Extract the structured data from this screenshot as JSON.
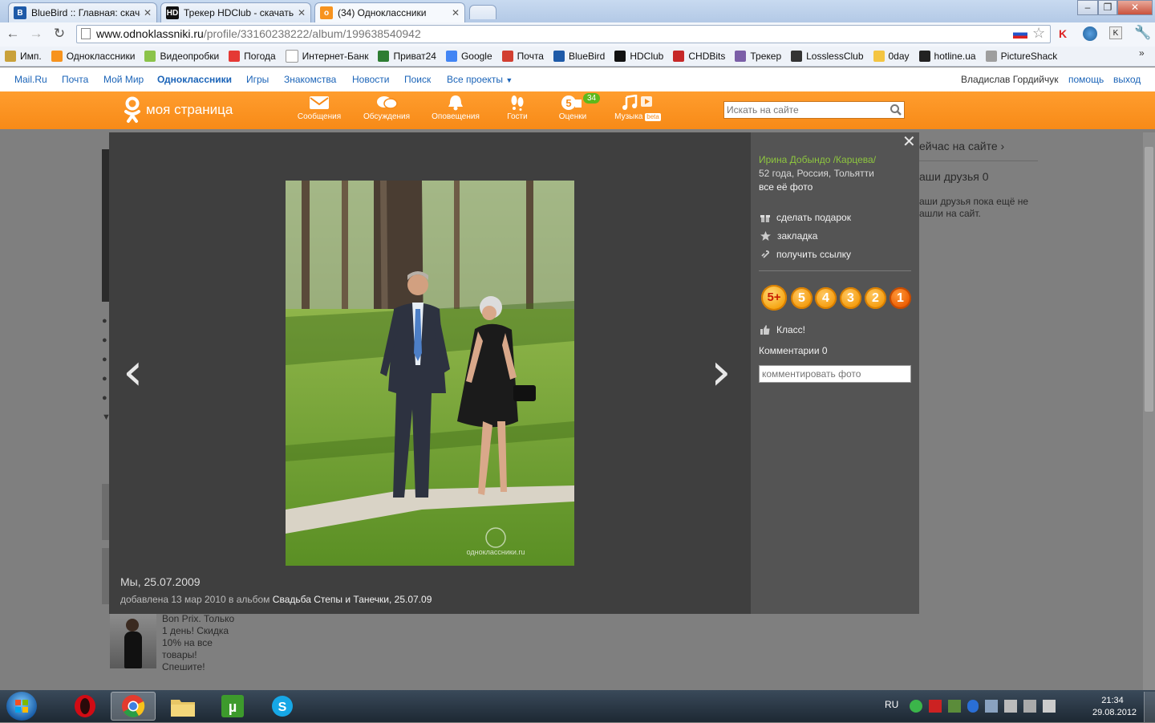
{
  "browser": {
    "tabs": [
      {
        "title": "BlueBird :: Главная: скачат",
        "icon": "bluebird-icon",
        "active": false
      },
      {
        "title": "Трекер HDClub - скачать",
        "icon": "hdclub-icon",
        "active": false
      },
      {
        "title": "(34) Одноклассники",
        "icon": "odnoklassniki-icon",
        "active": true
      }
    ],
    "url_host": "www.odnoklassniki.ru",
    "url_path": "/profile/33160238222/album/199638540942",
    "bookmarks": [
      {
        "label": "Имп.",
        "color": "#c9a13a"
      },
      {
        "label": "Одноклассники",
        "color": "#f7931e"
      },
      {
        "label": "Видеопробки",
        "color": "#8bc34a"
      },
      {
        "label": "Погода",
        "color": "#e53935"
      },
      {
        "label": "Интернет-Банк",
        "color": "#ffffff"
      },
      {
        "label": "Приват24",
        "color": "#2e7d32"
      },
      {
        "label": "Google",
        "color": "#4285f4"
      },
      {
        "label": "Почта",
        "color": "#d23f31"
      },
      {
        "label": "BlueBird",
        "color": "#1e5aa8"
      },
      {
        "label": "HDClub",
        "color": "#111111"
      },
      {
        "label": "CHDBits",
        "color": "#c62828"
      },
      {
        "label": "Трекер",
        "color": "#7b5ea7"
      },
      {
        "label": "LosslessClub",
        "color": "#333333"
      },
      {
        "label": "0day",
        "color": "#f4c542"
      },
      {
        "label": "hotline.ua",
        "color": "#222222"
      },
      {
        "label": "PictureShack",
        "color": "#9e9e9e"
      }
    ]
  },
  "mailbar": {
    "links": [
      "Mail.Ru",
      "Почта",
      "Мой Мир",
      "Одноклассники",
      "Игры",
      "Знакомства",
      "Новости",
      "Поиск",
      "Все проекты"
    ],
    "user": "Владислав Гордийчук",
    "help": "помощь",
    "logout": "выход"
  },
  "header": {
    "logo_text": "моя страница",
    "nav": [
      {
        "label": "Сообщения",
        "icon": "envelope-icon"
      },
      {
        "label": "Обсуждения",
        "icon": "discussions-icon"
      },
      {
        "label": "Оповещения",
        "icon": "bell-icon"
      },
      {
        "label": "Гости",
        "icon": "footprints-icon"
      },
      {
        "label": "Оценки",
        "icon": "ratings-icon"
      },
      {
        "label": "Музыка",
        "icon": "music-icon"
      }
    ],
    "ratings_badge": "34",
    "music_badge": "beta",
    "search_placeholder": "Искать на сайте"
  },
  "background_page": {
    "now_on_site": "ейчас на сайте ›",
    "friends_title": "аши друзья 0",
    "friends_note_1": "аши друзья пока ещё не",
    "friends_note_2": "ашли на сайт.",
    "ad_lines": [
      "Bon Prix. Только",
      "1 день! Скидка",
      "10% на все",
      "товары!",
      "Спешите!"
    ]
  },
  "viewer": {
    "owner_name": "Ирина Добындо /Карцева/",
    "owner_info": "52 года, Россия, Тольятти",
    "all_photos": "все её фото",
    "actions": [
      {
        "label": "сделать подарок",
        "icon": "gift-icon"
      },
      {
        "label": "закладка",
        "icon": "star-icon"
      },
      {
        "label": "получить ссылку",
        "icon": "link-icon"
      }
    ],
    "ratings": [
      "5+",
      "5",
      "4",
      "3",
      "2",
      "1"
    ],
    "like_label": "Класс!",
    "comments_label": "Комментарии 0",
    "comment_placeholder": "комментировать фото",
    "photo_title": "Мы, 25.07.2009",
    "added_prefix": "добавлена 13 мар 2010 в альбом ",
    "album_link": "Свадьба Степы и Танечки, 25.07.09",
    "watermark": "одноклассники.ru"
  },
  "taskbar": {
    "language": "RU",
    "time": "21:34",
    "date": "29.08.2012"
  },
  "colors": {
    "orange": "#f78a17",
    "link_blue": "#1b64b8",
    "owner_green": "#8ec63f"
  }
}
